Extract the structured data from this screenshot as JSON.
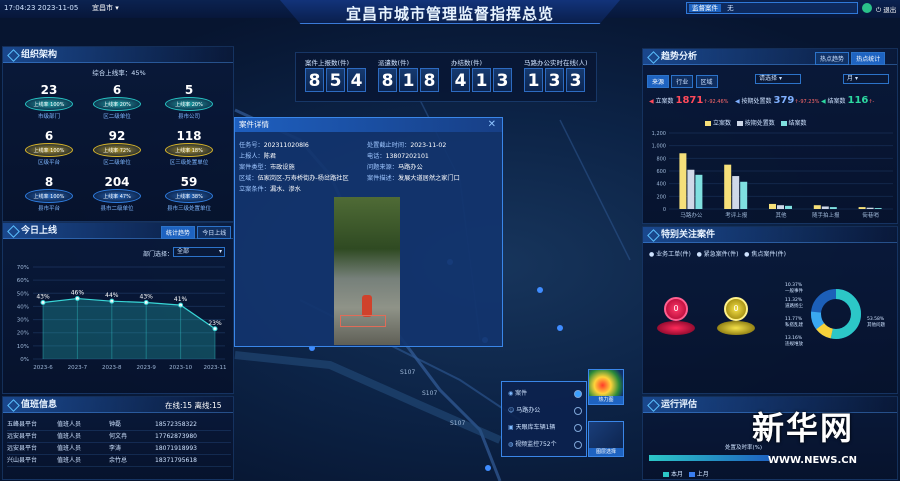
{
  "header": {
    "datetime": "17:04:23 2023-11-05",
    "city": "宜昌市",
    "title": "宜昌市城市管理监督指挥总览",
    "search_label": "监督案件",
    "search_value": "无",
    "logout": "退出",
    "toggle_on": true
  },
  "org": {
    "title": "组织架构",
    "rate": "综合上线率：45%",
    "cells": [
      {
        "num": "23",
        "rate": "上线率 100%",
        "name": "市级部门",
        "color": "#27c3c3"
      },
      {
        "num": "6",
        "rate": "上线率 20%",
        "name": "区二级单位",
        "color": "#27c3c3"
      },
      {
        "num": "5",
        "rate": "上线率 20%",
        "name": "县市公司",
        "color": "#27c3c3"
      },
      {
        "num": "6",
        "rate": "上线率 100%",
        "name": "区级平台",
        "color": "#d7b52a"
      },
      {
        "num": "92",
        "rate": "上线率 72%",
        "name": "区二级单位",
        "color": "#d7b52a"
      },
      {
        "num": "118",
        "rate": "上线率 18%",
        "name": "区三级处置单位",
        "color": "#d7b52a"
      },
      {
        "num": "8",
        "rate": "上线率 100%",
        "name": "县市平台",
        "color": "#2f7de0"
      },
      {
        "num": "204",
        "rate": "上线率 47%",
        "name": "县市二级单位",
        "color": "#2f7de0"
      },
      {
        "num": "59",
        "rate": "上线率 38%",
        "name": "县市三级处置单位",
        "color": "#2f7de0"
      }
    ]
  },
  "online": {
    "title": "今日上线",
    "btn1": "统计趋势",
    "btn2": "今日上线",
    "dept_label": "部门选择：",
    "dept_value": "全部"
  },
  "chart_data": {
    "type": "area",
    "categories": [
      "2023-6",
      "2023-7",
      "2023-8",
      "2023-9",
      "2023-10",
      "2023-11"
    ],
    "values": [
      43,
      46,
      44,
      43,
      41,
      23
    ],
    "labels": [
      "43%",
      "46%",
      "44%",
      "43%",
      "41%",
      "23%"
    ],
    "yticks": [
      "70%",
      "60%",
      "50%",
      "40%",
      "30%",
      "20%",
      "10%",
      "0%"
    ],
    "ylim": [
      0,
      70
    ]
  },
  "duty": {
    "title": "值班信息",
    "status": "在线:15 离线:15",
    "rows": [
      [
        "五峰县平台",
        "值班人员",
        "钟磊",
        "18572358322"
      ],
      [
        "远安县平台",
        "值班人员",
        "何文冉",
        "17762873980"
      ],
      [
        "远安县平台",
        "值班人员",
        "李涛",
        "18071918993"
      ],
      [
        "兴山县平台",
        "值班人员",
        "余竹总",
        "18371795618"
      ]
    ]
  },
  "kpis": [
    {
      "label": "案件上报数(件)",
      "digits": [
        "8",
        "5",
        "4"
      ]
    },
    {
      "label": "派遣数(件)",
      "digits": [
        "8",
        "1",
        "8"
      ]
    },
    {
      "label": "办结数(件)",
      "digits": [
        "4",
        "1",
        "3"
      ]
    },
    {
      "label": "马路办公实时在线(人)",
      "digits": [
        "1",
        "3",
        "3"
      ]
    }
  ],
  "case": {
    "title": "案件详情",
    "fields": [
      {
        "k": "任务号：",
        "v": "2023110208l6"
      },
      {
        "k": "处置截止时间：",
        "v": "2023-11-02"
      },
      {
        "k": "上报人：",
        "v": "陈君"
      },
      {
        "k": "电话：",
        "v": "13807202101"
      },
      {
        "k": "案件类型：",
        "v": "市政设施"
      },
      {
        "k": "问题来源：",
        "v": "马路办公"
      },
      {
        "k": "区域：",
        "v": "伍家岗区-万寿桥街办-杨岔路社区"
      },
      {
        "k": "案件描述：",
        "v": "发展大道居然之家门口"
      },
      {
        "k": "立案条件：",
        "v": "漏水、渗水"
      }
    ]
  },
  "map": {
    "roads": [
      "S107",
      "S107",
      "S107"
    ],
    "layers": [
      {
        "label": "案件"
      },
      {
        "label": "马路办公"
      },
      {
        "label": "天眼库车辆1辆"
      },
      {
        "label": "视频监控752个"
      }
    ],
    "heat_label": "热力图",
    "thumb_label": "图层选择"
  },
  "trend": {
    "title": "趋势分析",
    "tab1": "热点趋势",
    "tab2": "热点统计",
    "filters": [
      "来源",
      "行业",
      "区域"
    ],
    "select1": "请选择",
    "select2": "月",
    "stat_labels": [
      "立案数",
      "按期处置数",
      "结案数"
    ],
    "stat_values": [
      "1871",
      "379",
      "116"
    ],
    "stat_changes": [
      "↑-92.46%",
      "↑-97.23%",
      "↑-"
    ],
    "legend": [
      "立案数",
      "按期处置数",
      "结案数"
    ]
  },
  "trend_chart": {
    "type": "bar",
    "categories": [
      "马路办公",
      "考评上报",
      "其他",
      "随手拍上报",
      "街巷哨"
    ],
    "yticks": [
      "1,200",
      "1,000",
      "800",
      "600",
      "400",
      "200",
      "0"
    ],
    "ylim": [
      0,
      1200
    ],
    "series": [
      {
        "name": "立案数",
        "values": [
          880,
          700,
          80,
          60,
          30
        ]
      },
      {
        "name": "按期处置数",
        "values": [
          620,
          520,
          60,
          40,
          20
        ]
      },
      {
        "name": "结案数",
        "values": [
          540,
          430,
          50,
          30,
          15
        ]
      }
    ]
  },
  "special": {
    "title": "特别关注案件",
    "items": [
      "业务工单(件)",
      "紧急案件(件)",
      "焦点案件(件)"
    ],
    "vals": [
      "0",
      "0"
    ],
    "donut_labels": [
      "10.37%",
      "一般事件",
      "11.32%",
      "道路扬尘",
      "11.77%",
      "私搭乱建",
      "13.16%",
      "违规堆放",
      "53.58%",
      "其他问题"
    ]
  },
  "run": {
    "title": "运行评估",
    "axis_label": "处置及时率(%)",
    "legend": [
      "本月",
      "上月"
    ]
  },
  "watermark": {
    "cn": "新华网",
    "en": "WWW.NEWS.CN"
  }
}
